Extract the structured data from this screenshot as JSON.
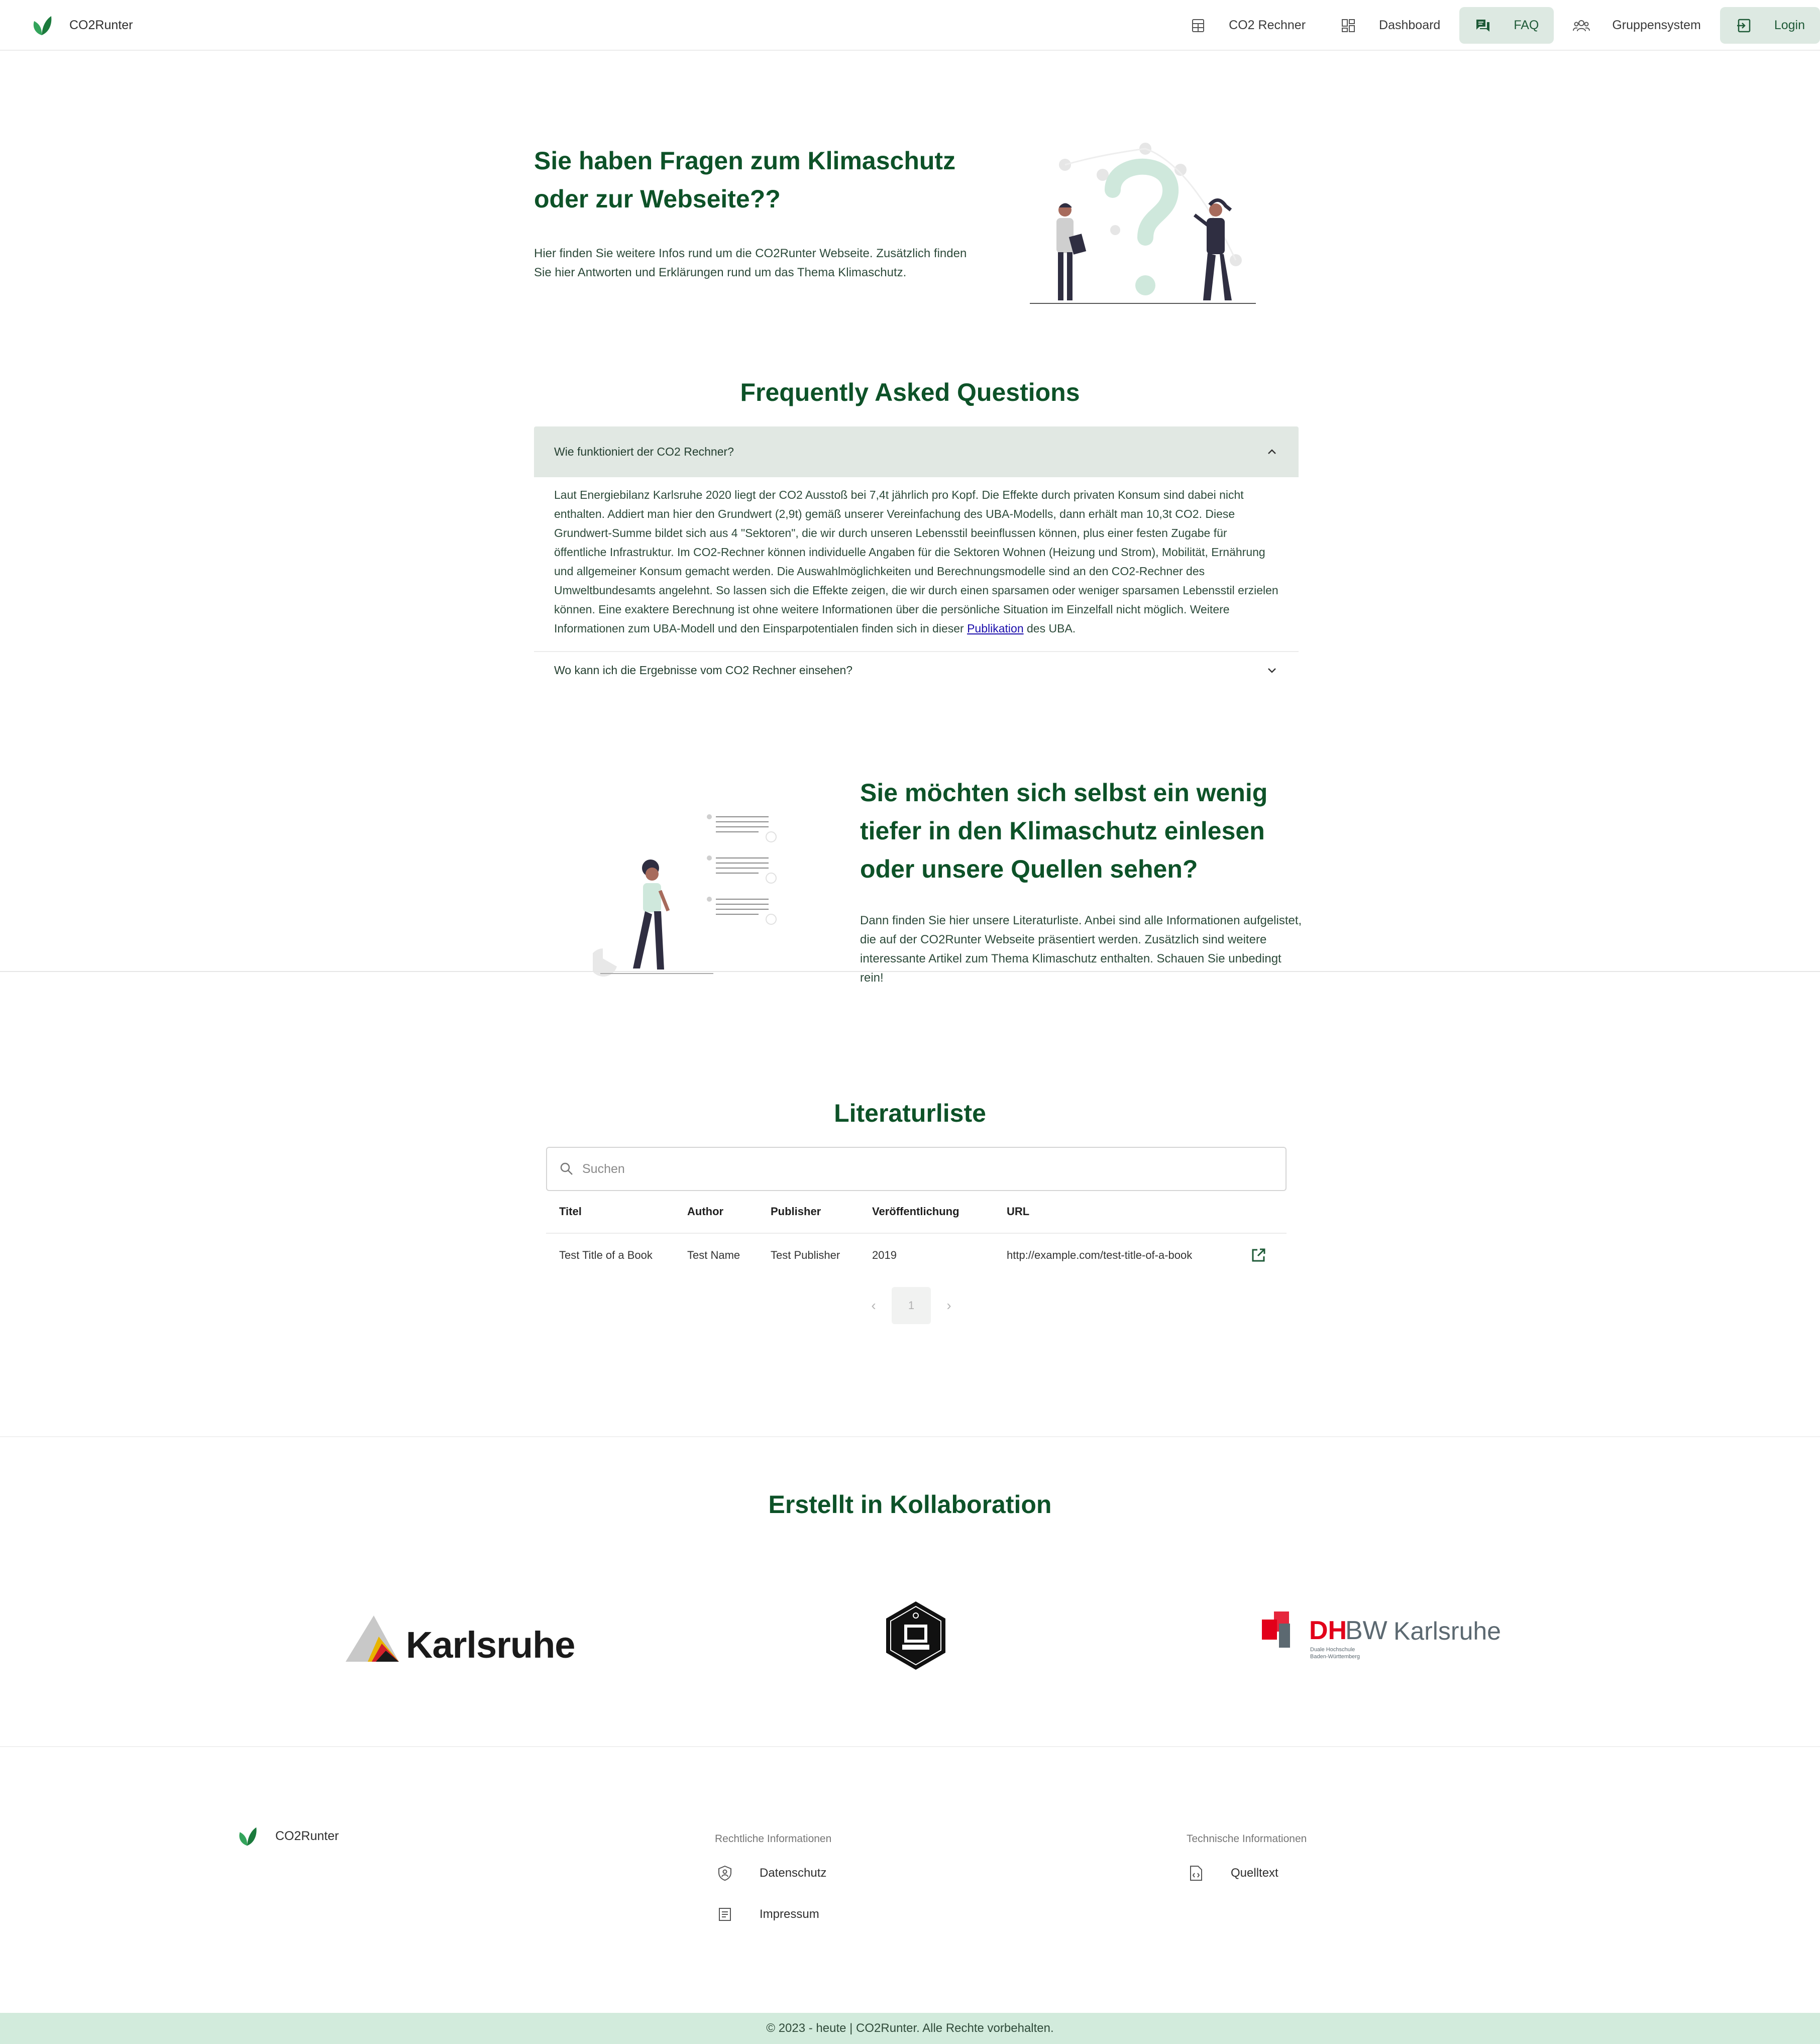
{
  "header": {
    "brand": "CO2Runter",
    "nav": [
      {
        "label": "CO2 Rechner",
        "icon": "calculator-icon"
      },
      {
        "label": "Dashboard",
        "icon": "dashboard-icon"
      },
      {
        "label": "FAQ",
        "icon": "faq-icon",
        "active": true
      },
      {
        "label": "Gruppensystem",
        "icon": "group-icon"
      },
      {
        "label": "Login",
        "icon": "login-icon"
      }
    ]
  },
  "hero": {
    "title": "Sie haben Fragen zum Klimaschutz oder zur Webseite??",
    "text": "Hier finden Sie weitere Infos rund um die CO2Runter Webseite. Zusätzlich finden Sie hier Antworten und Erklärungen rund um das Thema Klimaschutz."
  },
  "faq": {
    "title": "Frequently Asked Questions",
    "items": [
      {
        "question": "Wie funktioniert der CO2 Rechner?",
        "answer": "Laut Energiebilanz Karlsruhe 2020 liegt der CO2 Ausstoß bei 7,4t jährlich pro Kopf. Die Effekte durch privaten Konsum sind dabei nicht enthalten. Addiert man hier den Grundwert (2,9t) gemäß unserer Vereinfachung des UBA-Modells, dann erhält man 10,3t CO2. Diese Grundwert-Summe bildet sich aus 4 \"Sektoren\", die wir durch unseren Lebensstil beeinflussen können, plus einer festen Zugabe für öffentliche Infrastruktur. Im CO2-Rechner können individuelle Angaben für die Sektoren Wohnen (Heizung und Strom), Mobilität, Ernährung und allgemeiner Konsum gemacht werden. Die Auswahlmöglichkeiten und Berechnungsmodelle sind an den CO2-Rechner des Umweltbundesamts angelehnt. So lassen sich die Effekte zeigen, die wir durch einen sparsamen oder weniger sparsamen Lebensstil erzielen können. Eine exaktere Berechnung ist ohne weitere Informationen über die persönliche Situation im Einzelfall nicht möglich. Weitere Informationen zum UBA-Modell und den Einsparpotentialen finden sich in dieser",
        "link_text": "Publikation",
        "answer_end": "des UBA."
      },
      {
        "question": "Wo kann ich die Ergebnisse vom CO2 Rechner einsehen?"
      }
    ]
  },
  "literature_intro": {
    "title": "Sie möchten sich selbst ein wenig tiefer in den Klimaschutz einlesen oder unsere Quellen sehen?",
    "text": "Dann finden Sie hier unsere Literaturliste. Anbei sind alle Informationen aufgelistet, die auf der CO2Runter Webseite präsentiert werden. Zusätzlich sind weitere interessante Artikel zum Thema Klimaschutz enthalten. Schauen Sie unbedingt rein!"
  },
  "literature": {
    "title": "Literaturliste",
    "search_placeholder": "Suchen",
    "columns": [
      "Titel",
      "Author",
      "Publisher",
      "Veröffentlichung",
      "URL"
    ],
    "rows": [
      {
        "title": "Test Title of a Book",
        "author": "Test Name",
        "publisher": "Test Publisher",
        "year": "2019",
        "url": "http://example.com/test-title-of-a-book"
      }
    ],
    "page": "1"
  },
  "collab": {
    "title": "Erstellt in Kollaboration",
    "karlsruhe": "Karlsruhe",
    "dhbw_a": "DH",
    "dhbw_b": "BW",
    "dhbw_city": "Karlsruhe",
    "dhbw_sub1": "Duale Hochschule",
    "dhbw_sub2": "Baden-Württemberg"
  },
  "footer": {
    "brand": "CO2Runter",
    "legal_heading": "Rechtliche Informationen",
    "legal_links": [
      "Datenschutz",
      "Impressum"
    ],
    "tech_heading": "Technische Informationen",
    "tech_links": [
      "Quelltext"
    ],
    "copyright": "© 2023 - heute | CO2Runter. Alle Rechte vorbehalten."
  },
  "colors": {
    "accent": "#0d5228",
    "active_bg": "#dde9e2",
    "copy_bg": "#d2ebdc"
  }
}
